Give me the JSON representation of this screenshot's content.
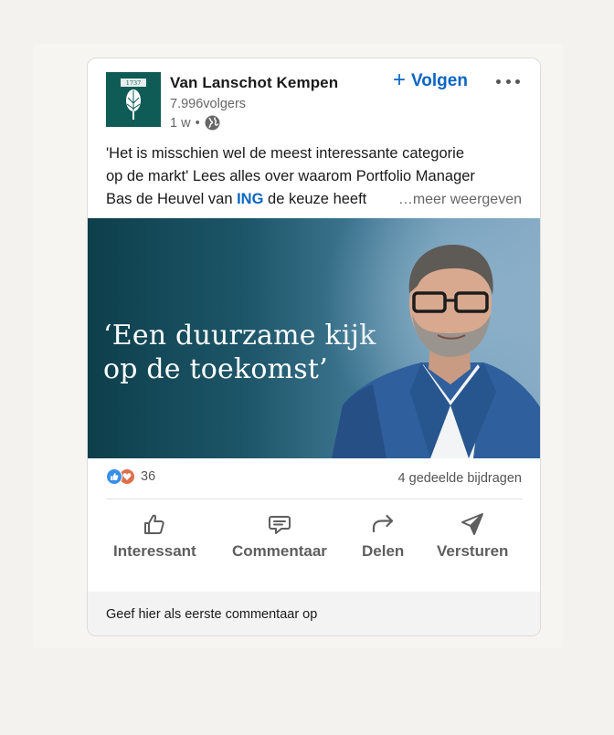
{
  "post": {
    "company_name": "Van Lanschot Kempen",
    "logo_year": "1737",
    "followers": "7.996volgers",
    "time": "1 w",
    "meta_separator": "•",
    "visibility_icon": "globe-icon",
    "follow_label": "Volgen",
    "follow_icon": "plus-icon",
    "more_icon": "ellipsis-icon",
    "text_line1": "'Het is misschien wel de meest interessante categorie",
    "text_line2": "op de markt' Lees alles over waarom Portfolio Manager",
    "text_line3_before": "Bas de Heuvel van ",
    "text_mention": "ING",
    "text_line3_after": " de keuze heeft",
    "see_more": "…meer weergeven",
    "banner_quote_line1": "‘Een duurzame kijk",
    "banner_quote_line2": "op de toekomst’"
  },
  "stats": {
    "reaction_icons": [
      "like-reaction-icon",
      "love-reaction-icon"
    ],
    "reaction_count": "36",
    "shares": "4 gedeelde bijdragen"
  },
  "actions": [
    {
      "label": "Interessant",
      "icon": "thumbs-up-icon"
    },
    {
      "label": "Commentaar",
      "icon": "comment-icon"
    },
    {
      "label": "Delen",
      "icon": "share-arrow-icon"
    },
    {
      "label": "Versturen",
      "icon": "send-icon"
    }
  ],
  "comment_bar": {
    "placeholder": "Geef hier als eerste commentaar op"
  },
  "colors": {
    "accent": "#0a66c2",
    "logo_bg": "#0f5c57",
    "banner_dark": "#0d3f4b",
    "banner_light": "#86aac4"
  }
}
